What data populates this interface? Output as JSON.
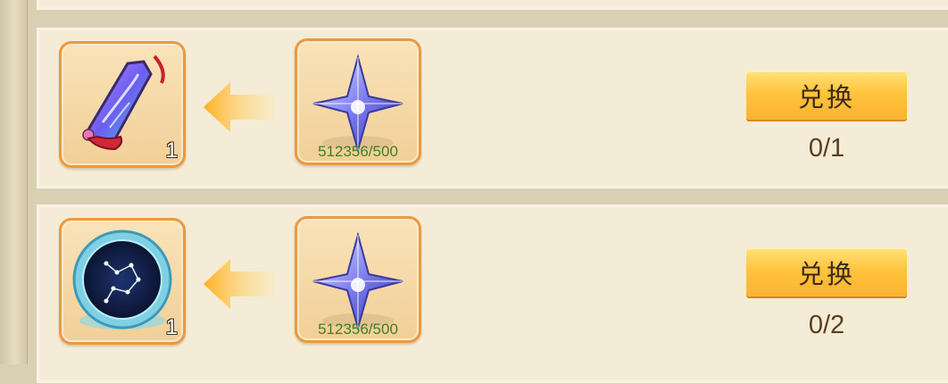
{
  "colors": {
    "panel_bg": "#f4ecd6",
    "slot_border": "#e99a42",
    "button_gold": "#ffc43c",
    "cost_text": "#3f7f22",
    "progress_text": "#5a3e1e",
    "arrow": "#ffc033"
  },
  "exchange_list": [
    {
      "reward": {
        "icon": "purple-pendant-icon",
        "count": "1"
      },
      "cost": {
        "icon": "star-crystal-icon",
        "amount": "512356/500"
      },
      "button_label": "兑换",
      "progress": "0/1"
    },
    {
      "reward": {
        "icon": "constellation-mirror-icon",
        "count": "1"
      },
      "cost": {
        "icon": "star-crystal-icon",
        "amount": "512356/500"
      },
      "button_label": "兑换",
      "progress": "0/2"
    }
  ]
}
